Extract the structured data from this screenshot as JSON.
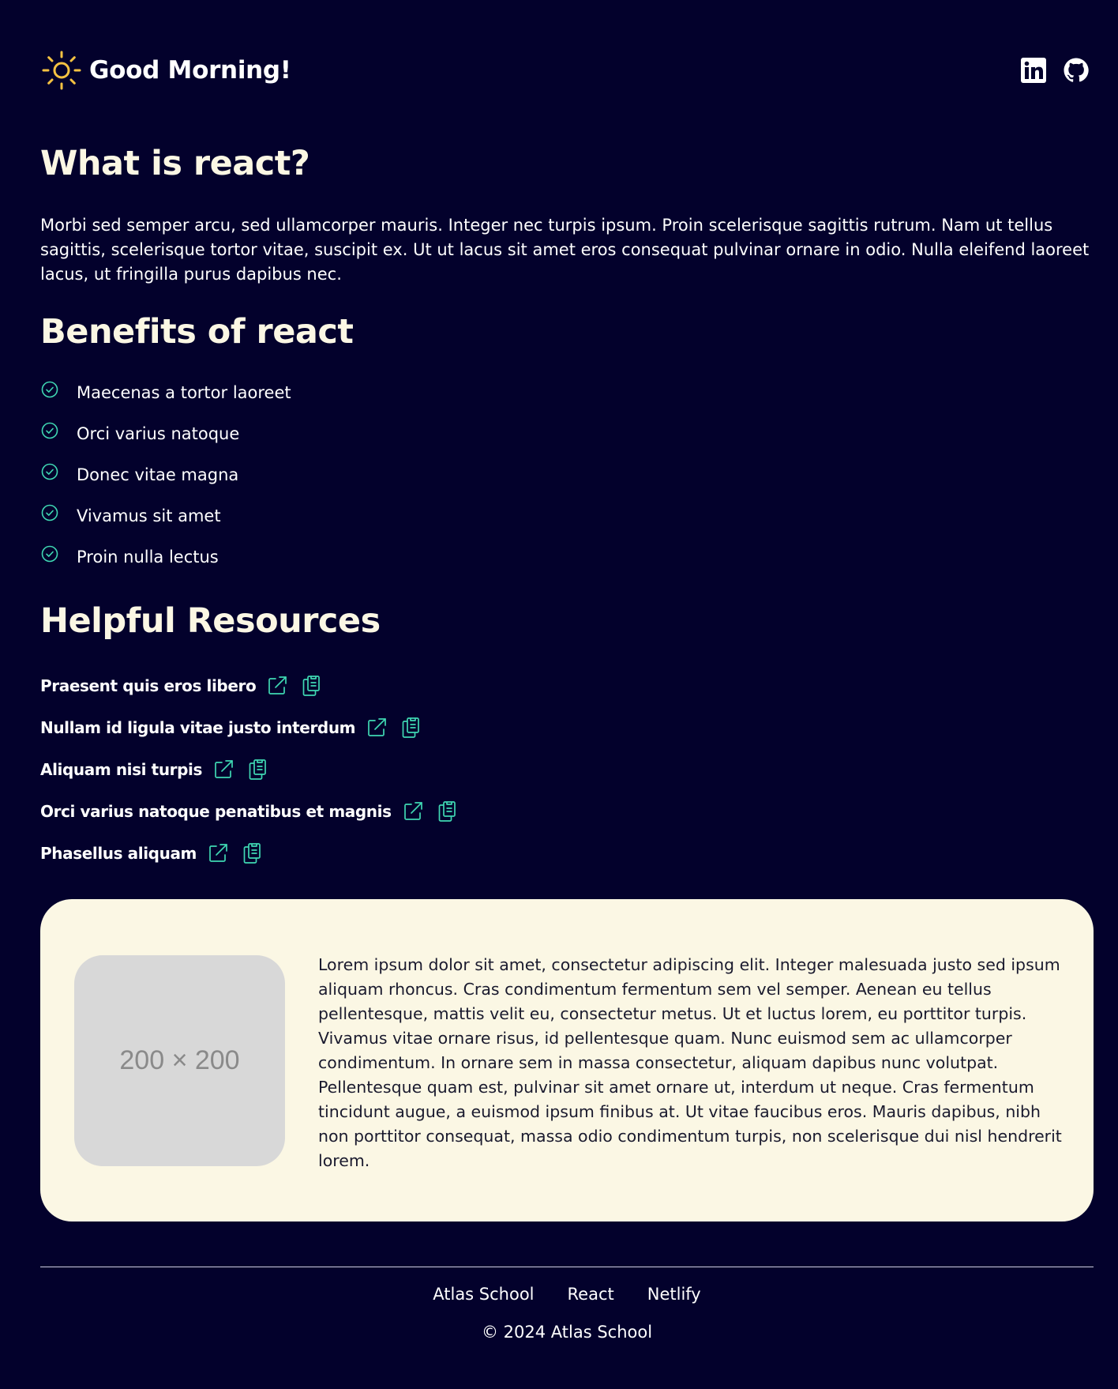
{
  "header": {
    "greeting": "Good Morning!",
    "icon": "sun-icon",
    "social": [
      {
        "icon": "linkedin-icon"
      },
      {
        "icon": "github-icon"
      }
    ]
  },
  "main": {
    "title": "What is react?",
    "intro": "Morbi sed semper arcu, sed ullamcorper mauris. Integer nec turpis ipsum. Proin scelerisque sagittis rutrum. Nam ut tellus sagittis, scelerisque tortor vitae, suscipit ex. Ut ut lacus sit amet eros consequat pulvinar ornare in odio. Nulla eleifend laoreet lacus, ut fringilla purus dapibus nec.",
    "benefits_heading": "Benefits of react",
    "benefits": [
      "Maecenas a tortor laoreet",
      "Orci varius natoque",
      "Donec vitae magna",
      "Vivamus sit amet",
      "Proin nulla lectus"
    ],
    "resources_heading": "Helpful Resources",
    "resources": [
      {
        "title": "Praesent quis eros libero"
      },
      {
        "title": "Nullam id ligula vitae justo interdum"
      },
      {
        "title": "Aliquam nisi turpis"
      },
      {
        "title": "Orci varius natoque penatibus et magnis"
      },
      {
        "title": "Phasellus aliquam"
      }
    ]
  },
  "card": {
    "image_placeholder": "200 × 200",
    "text": "Lorem ipsum dolor sit amet, consectetur adipiscing elit. Integer malesuada justo sed ipsum aliquam rhoncus. Cras condimentum fermentum sem vel semper. Aenean eu tellus pellentesque, mattis velit eu, consectetur metus. Ut et luctus lorem, eu porttitor turpis. Vivamus vitae ornare risus, id pellentesque quam. Nunc euismod sem ac ullamcorper condimentum. In ornare sem in massa consectetur, aliquam dapibus nunc volutpat. Pellentesque quam est, pulvinar sit amet ornare ut, interdum ut neque. Cras fermentum tincidunt augue, a euismod ipsum finibus at. Ut vitae faucibus eros. Mauris dapibus, nibh non porttitor consequat, massa odio condimentum turpis, non scelerisque dui nisl hendrerit lorem."
  },
  "footer": {
    "links": [
      "Atlas School",
      "React",
      "Netlify"
    ],
    "copyright": "© 2024 Atlas School"
  },
  "colors": {
    "background": "#03012c",
    "accent": "#3fd8b3",
    "sun": "#f5c242",
    "card": "#fbf7e4"
  }
}
